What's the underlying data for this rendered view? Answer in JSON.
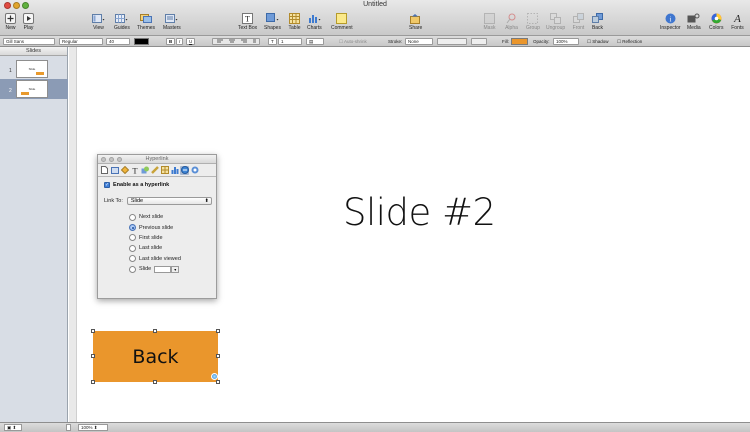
{
  "window": {
    "title": "Untitled"
  },
  "toolbar": {
    "new": "New",
    "play": "Play",
    "view": "View",
    "guides": "Guides",
    "themes": "Themes",
    "masters": "Masters",
    "text_box": "Text Box",
    "shapes": "Shapes",
    "table": "Table",
    "charts": "Charts",
    "comment": "Comment",
    "share": "Share",
    "mask": "Mask",
    "alpha": "Alpha",
    "group": "Group",
    "ungroup": "Ungroup",
    "front": "Front",
    "back": "Back",
    "inspector": "Inspector",
    "media": "Media",
    "colors": "Colors",
    "fonts": "Fonts"
  },
  "format_bar": {
    "font_family": "Gill Sans",
    "font_style": "Regular",
    "font_size": "40",
    "bold": "B",
    "italic": "I",
    "underline": "U",
    "line_spacing": "1",
    "autoshrink": "Auto-shrink",
    "stroke_label": "Stroke:",
    "stroke_value": "None",
    "fill_label": "Fill:",
    "opacity_label": "Opacity:",
    "opacity_value": "100%",
    "shadow": "Shadow",
    "reflection": "Reflection",
    "fill_color": "#ea962c",
    "text_color": "#000000"
  },
  "navigator": {
    "header": "Slides",
    "slides": [
      {
        "number": "1",
        "thumb_text": "Slide"
      },
      {
        "number": "2",
        "thumb_text": "Slide"
      }
    ]
  },
  "canvas": {
    "title": "Slide #2",
    "button_label": "Back",
    "button_color": "#ea962c"
  },
  "inspector": {
    "title": "Hyperlink",
    "enable_label": "Enable as a hyperlink",
    "link_to_label": "Link To:",
    "link_to_value": "Slide",
    "options": [
      "Next slide",
      "Previous slide",
      "First slide",
      "Last slide",
      "Last slide viewed",
      "Slide"
    ],
    "selected_option": "Previous slide",
    "slide_number": ""
  },
  "status_bar": {
    "zoom": "100%"
  }
}
